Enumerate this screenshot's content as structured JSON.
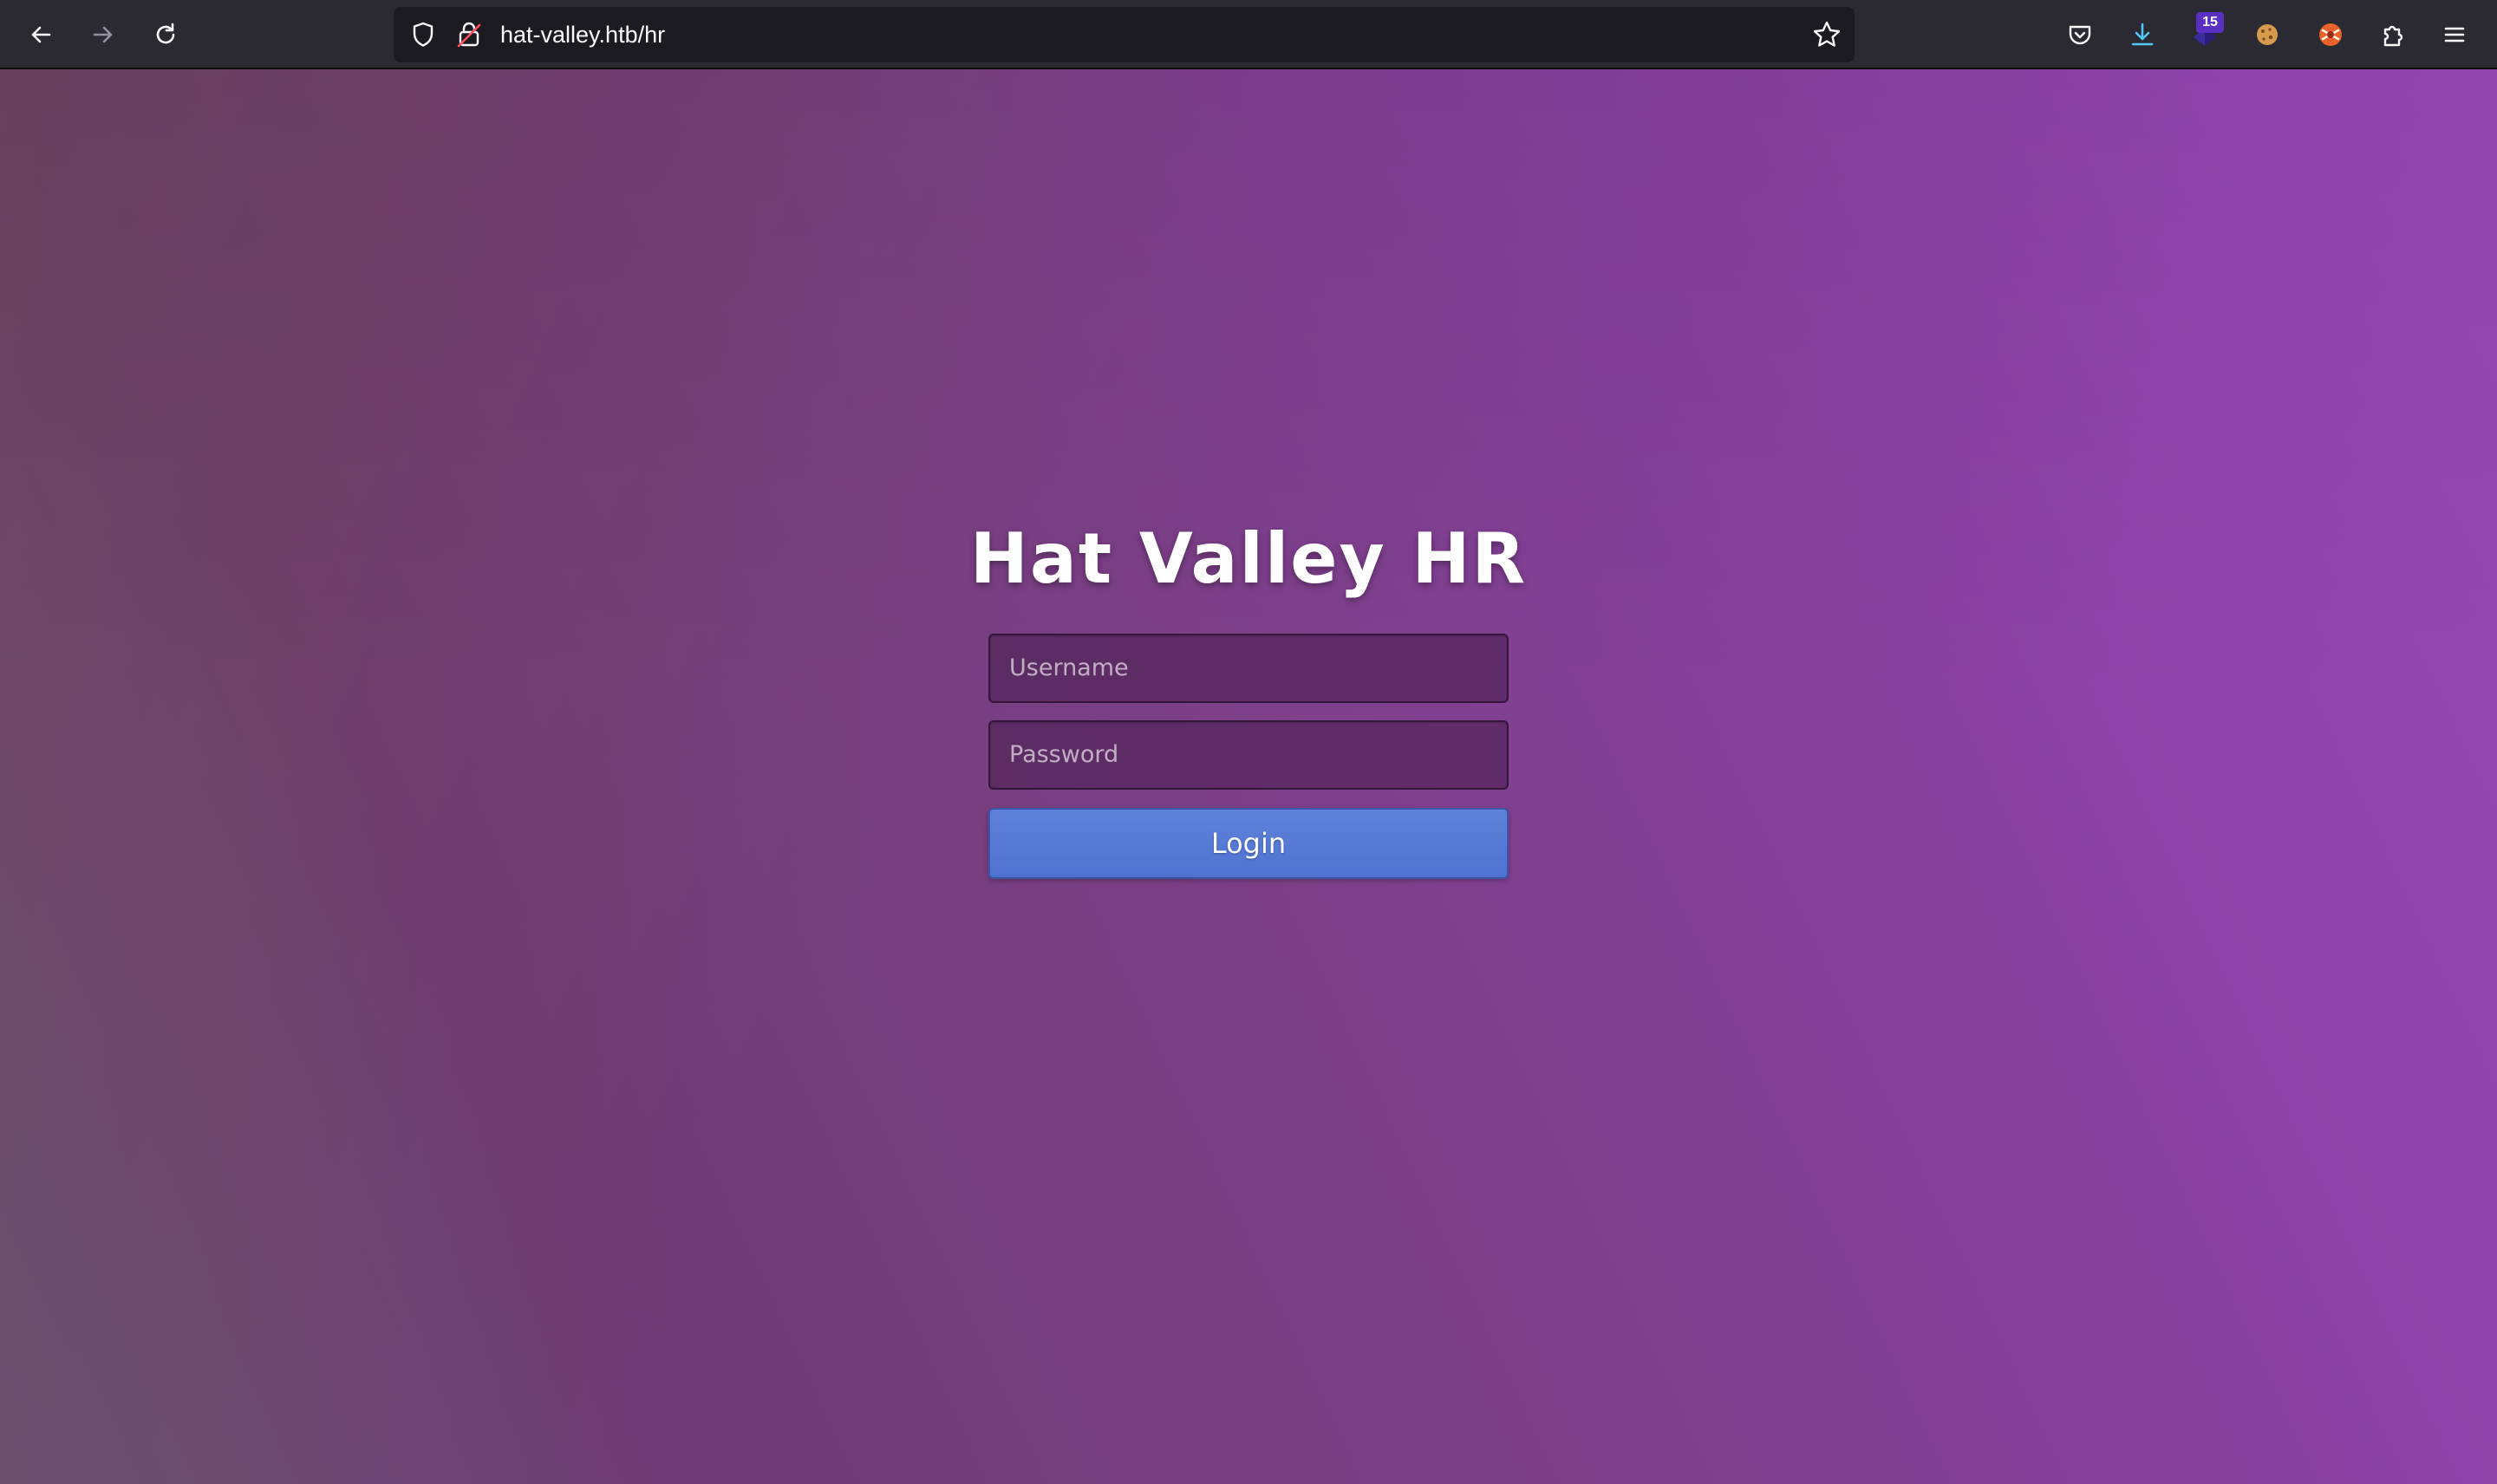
{
  "browser": {
    "url": "hat-valley.htb/hr",
    "extension_badge": "15",
    "icons": {
      "back": "arrow-left-icon",
      "forward": "arrow-right-icon",
      "reload": "reload-icon",
      "tracking_protection": "shield-icon",
      "insecure_lock": "lock-insecure-icon",
      "bookmark": "star-icon",
      "pocket": "pocket-icon",
      "downloads": "download-icon",
      "extension_1": "extension-badge-icon",
      "extension_2": "cookie-icon",
      "extension_3": "burp-extension-icon",
      "extensions": "puzzle-icon",
      "menu": "hamburger-menu-icon"
    }
  },
  "login": {
    "title": "Hat Valley HR",
    "username_placeholder": "Username",
    "password_placeholder": "Password",
    "login_label": "Login"
  },
  "colors": {
    "toolbar_bg": "#2b2a33",
    "urlbar_bg": "#1c1b22",
    "button_blue": "#5577d6",
    "badge_purple": "#5b2fc2",
    "gradient_start": "#6a5276",
    "gradient_end": "#9a49b8"
  }
}
